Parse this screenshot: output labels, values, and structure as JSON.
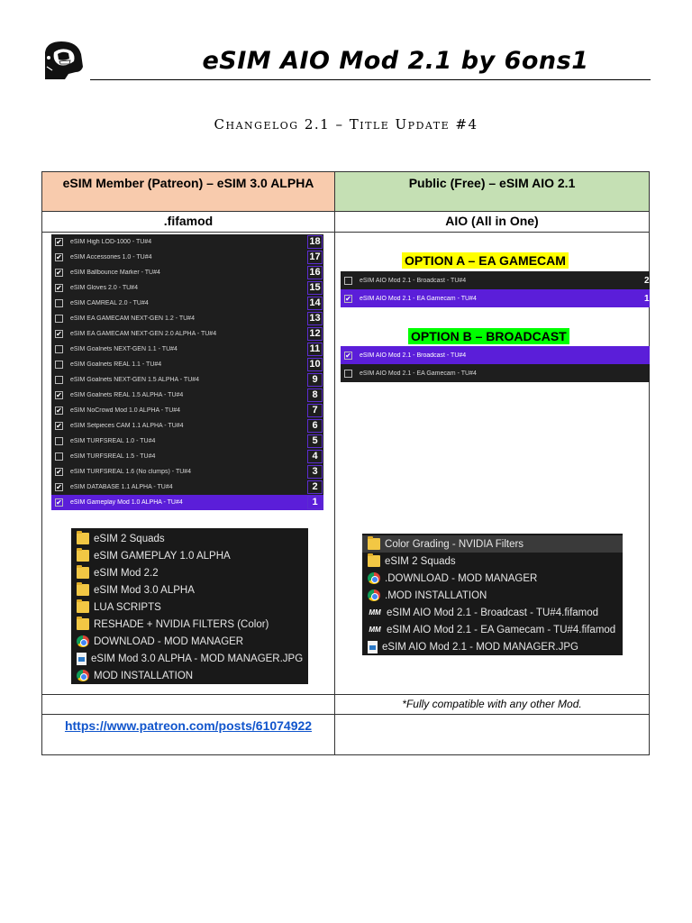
{
  "header": {
    "title": "eSIM AIO Mod 2.1 by 6ons1",
    "subtitle": "Changelog 2.1 – Title Update #4"
  },
  "table": {
    "left_header": "eSIM Member (Patreon) – eSIM 3.0 ALPHA",
    "right_header": "Public (Free) – eSIM AIO 2.1",
    "left_sub": ".fifamod",
    "right_sub": "AIO (All in One)",
    "note": "*Fully compatible with any other Mod.",
    "link": "https://www.patreon.com/posts/61074922"
  },
  "mods": [
    {
      "label": "eSIM High LOD-1000 - TU#4",
      "checked": true,
      "priority": "18"
    },
    {
      "label": "eSIM Accessories 1.0 - TU#4",
      "checked": true,
      "priority": "17"
    },
    {
      "label": "eSIM Ballbounce Marker - TU#4",
      "checked": true,
      "priority": "16"
    },
    {
      "label": "eSIM Gloves 2.0 - TU#4",
      "checked": true,
      "priority": "15"
    },
    {
      "label": "eSIM CAMREAL 2.0 - TU#4",
      "checked": false,
      "priority": "14"
    },
    {
      "label": "eSIM EA GAMECAM NEXT-GEN 1.2 - TU#4",
      "checked": false,
      "priority": "13"
    },
    {
      "label": "eSIM EA GAMECAM NEXT-GEN 2.0 ALPHA - TU#4",
      "checked": true,
      "priority": "12"
    },
    {
      "label": "eSIM Goalnets NEXT-GEN 1.1 - TU#4",
      "checked": false,
      "priority": "11"
    },
    {
      "label": "eSIM Goalnets REAL 1.1 - TU#4",
      "checked": false,
      "priority": "10"
    },
    {
      "label": "eSIM Goalnets NEXT-GEN 1.5 ALPHA - TU#4",
      "checked": false,
      "priority": "9"
    },
    {
      "label": "eSIM Goalnets REAL 1.5 ALPHA - TU#4",
      "checked": true,
      "priority": "8"
    },
    {
      "label": "eSIM NoCrowd Mod 1.0 ALPHA - TU#4",
      "checked": true,
      "priority": "7"
    },
    {
      "label": "eSIM Setpieces CAM 1.1 ALPHA - TU#4",
      "checked": true,
      "priority": "6"
    },
    {
      "label": "eSIM TURFSREAL 1.0 - TU#4",
      "checked": false,
      "priority": "5"
    },
    {
      "label": "eSIM TURFSREAL 1.5 - TU#4",
      "checked": false,
      "priority": "4"
    },
    {
      "label": "eSIM TURFSREAL 1.6 (No clumps) - TU#4",
      "checked": true,
      "priority": "3"
    },
    {
      "label": "eSIM DATABASE 1.1 ALPHA - TU#4",
      "checked": true,
      "priority": "2"
    },
    {
      "label": "eSIM Gameplay Mod 1.0 ALPHA - TU#4",
      "checked": true,
      "priority": "1",
      "selected": true
    }
  ],
  "left_files": [
    {
      "icon": "folder-icon",
      "label": "eSIM 2 Squads"
    },
    {
      "icon": "folder-icon",
      "label": "eSIM GAMEPLAY 1.0 ALPHA"
    },
    {
      "icon": "folder-icon",
      "label": "eSIM Mod 2.2"
    },
    {
      "icon": "folder-icon",
      "label": "eSIM Mod 3.0 ALPHA"
    },
    {
      "icon": "folder-icon",
      "label": "LUA SCRIPTS"
    },
    {
      "icon": "folder-icon",
      "label": "RESHADE + NVIDIA FILTERS (Color)"
    },
    {
      "icon": "chrome-icon",
      "label": "DOWNLOAD - MOD MANAGER"
    },
    {
      "icon": "image-file-icon",
      "label": "eSIM Mod 3.0 ALPHA - MOD MANAGER.JPG"
    },
    {
      "icon": "chrome-icon",
      "label": "MOD INSTALLATION"
    }
  ],
  "option_a": {
    "label": "OPTION A – EA GAMECAM",
    "rows": [
      {
        "label": "eSIM AIO Mod 2.1 - Broadcast - TU#4",
        "checked": false,
        "priority": "2",
        "selected": false
      },
      {
        "label": "eSIM AIO Mod 2.1 - EA Gamecam - TU#4",
        "checked": true,
        "priority": "1",
        "selected": true
      }
    ]
  },
  "option_b": {
    "label": "OPTION B – BROADCAST",
    "rows": [
      {
        "label": "eSIM AIO Mod 2.1 - Broadcast - TU#4",
        "checked": true,
        "priority": "",
        "selected": true
      },
      {
        "label": "eSIM AIO Mod 2.1 - EA Gamecam - TU#4",
        "checked": false,
        "priority": "",
        "selected": false
      }
    ]
  },
  "right_files": [
    {
      "icon": "folder-icon",
      "label": "Color Grading - NVIDIA Filters"
    },
    {
      "icon": "folder-icon",
      "label": "eSIM 2 Squads"
    },
    {
      "icon": "chrome-icon",
      "label": ".DOWNLOAD - MOD MANAGER"
    },
    {
      "icon": "chrome-icon",
      "label": ".MOD INSTALLATION"
    },
    {
      "icon": "mod-manager-icon",
      "label": "eSIM AIO Mod 2.1 - Broadcast - TU#4.fifamod"
    },
    {
      "icon": "mod-manager-icon",
      "label": "eSIM AIO Mod 2.1 - EA Gamecam - TU#4.fifamod"
    },
    {
      "icon": "image-file-icon",
      "label": "eSIM AIO Mod 2.1 - MOD MANAGER.JPG"
    }
  ]
}
